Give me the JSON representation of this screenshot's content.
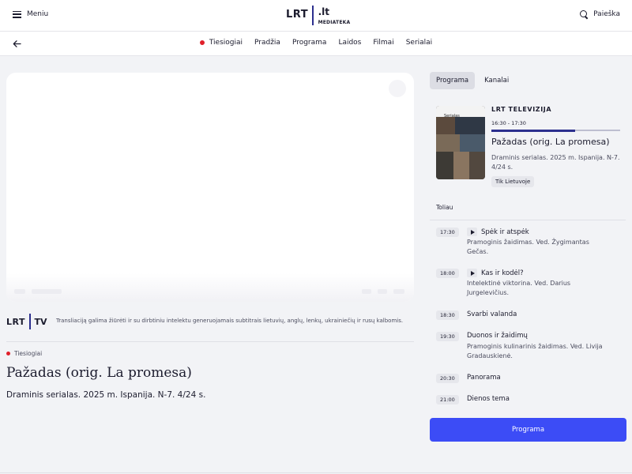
{
  "header": {
    "menu_label": "Meniu",
    "logo_left": "LRT",
    "logo_lt": ".lt",
    "logo_sub": "MEDIATEKA",
    "search_label": "Paieška"
  },
  "nav": {
    "items": [
      {
        "label": "Tiesiogiai",
        "live": true
      },
      {
        "label": "Pradžia"
      },
      {
        "label": "Programa"
      },
      {
        "label": "Laidos"
      },
      {
        "label": "Filmai"
      },
      {
        "label": "Serialai"
      }
    ]
  },
  "player": {
    "broadcaster_left": "LRT",
    "broadcaster_right": "TV",
    "ai_note": "Transliaciją galima žiūrėti ir su dirbtiniu intelektu generuojamais subtitrais lietuvių, anglų, lenkų, ukrainiečių ir rusų kalbomis."
  },
  "current": {
    "live_label": "Tiesiogiai",
    "title": "Pažadas (orig. La promesa)",
    "description": "Draminis serialas. 2025 m. Ispanija. N-7. 4/24 s."
  },
  "sidebar": {
    "tabs": [
      "Programa",
      "Kanalai"
    ],
    "now": {
      "thumb_label": "Serialas",
      "channel": "LRT TELEVIZIJA",
      "time": "16:30 - 17:30",
      "progress": 0.65,
      "title": "Pažadas (orig. La promesa)",
      "description": "Draminis serialas. 2025 m. Ispanija. N-7. 4/24 s.",
      "badge": "Tik Lietuvoje"
    },
    "next_label": "Toliau",
    "schedule": [
      {
        "time": "17:30",
        "title": "Spėk ir atspėk",
        "description": "Pramoginis žaidimas. Ved. Žygimantas Gečas.",
        "playable": true
      },
      {
        "time": "18:00",
        "title": "Kas ir kodėl?",
        "description": "Intelektinė viktorina. Ved. Darius Jurgelevičius.",
        "playable": true
      },
      {
        "time": "18:30",
        "title": "Svarbi valanda",
        "description": "",
        "playable": false
      },
      {
        "time": "19:30",
        "title": "Duonos ir žaidimų",
        "description": "Pramoginis kulinarinis žaidimas. Ved. Livija Gradauskienė.",
        "playable": false
      },
      {
        "time": "20:30",
        "title": "Panorama",
        "description": "",
        "playable": false
      },
      {
        "time": "21:00",
        "title": "Dienos tema",
        "description": "",
        "playable": false
      }
    ],
    "program_button": "Programa"
  },
  "colors": {
    "accent": "#3c4cf6",
    "live": "#e0202a",
    "brand": "#2c2f8e"
  }
}
